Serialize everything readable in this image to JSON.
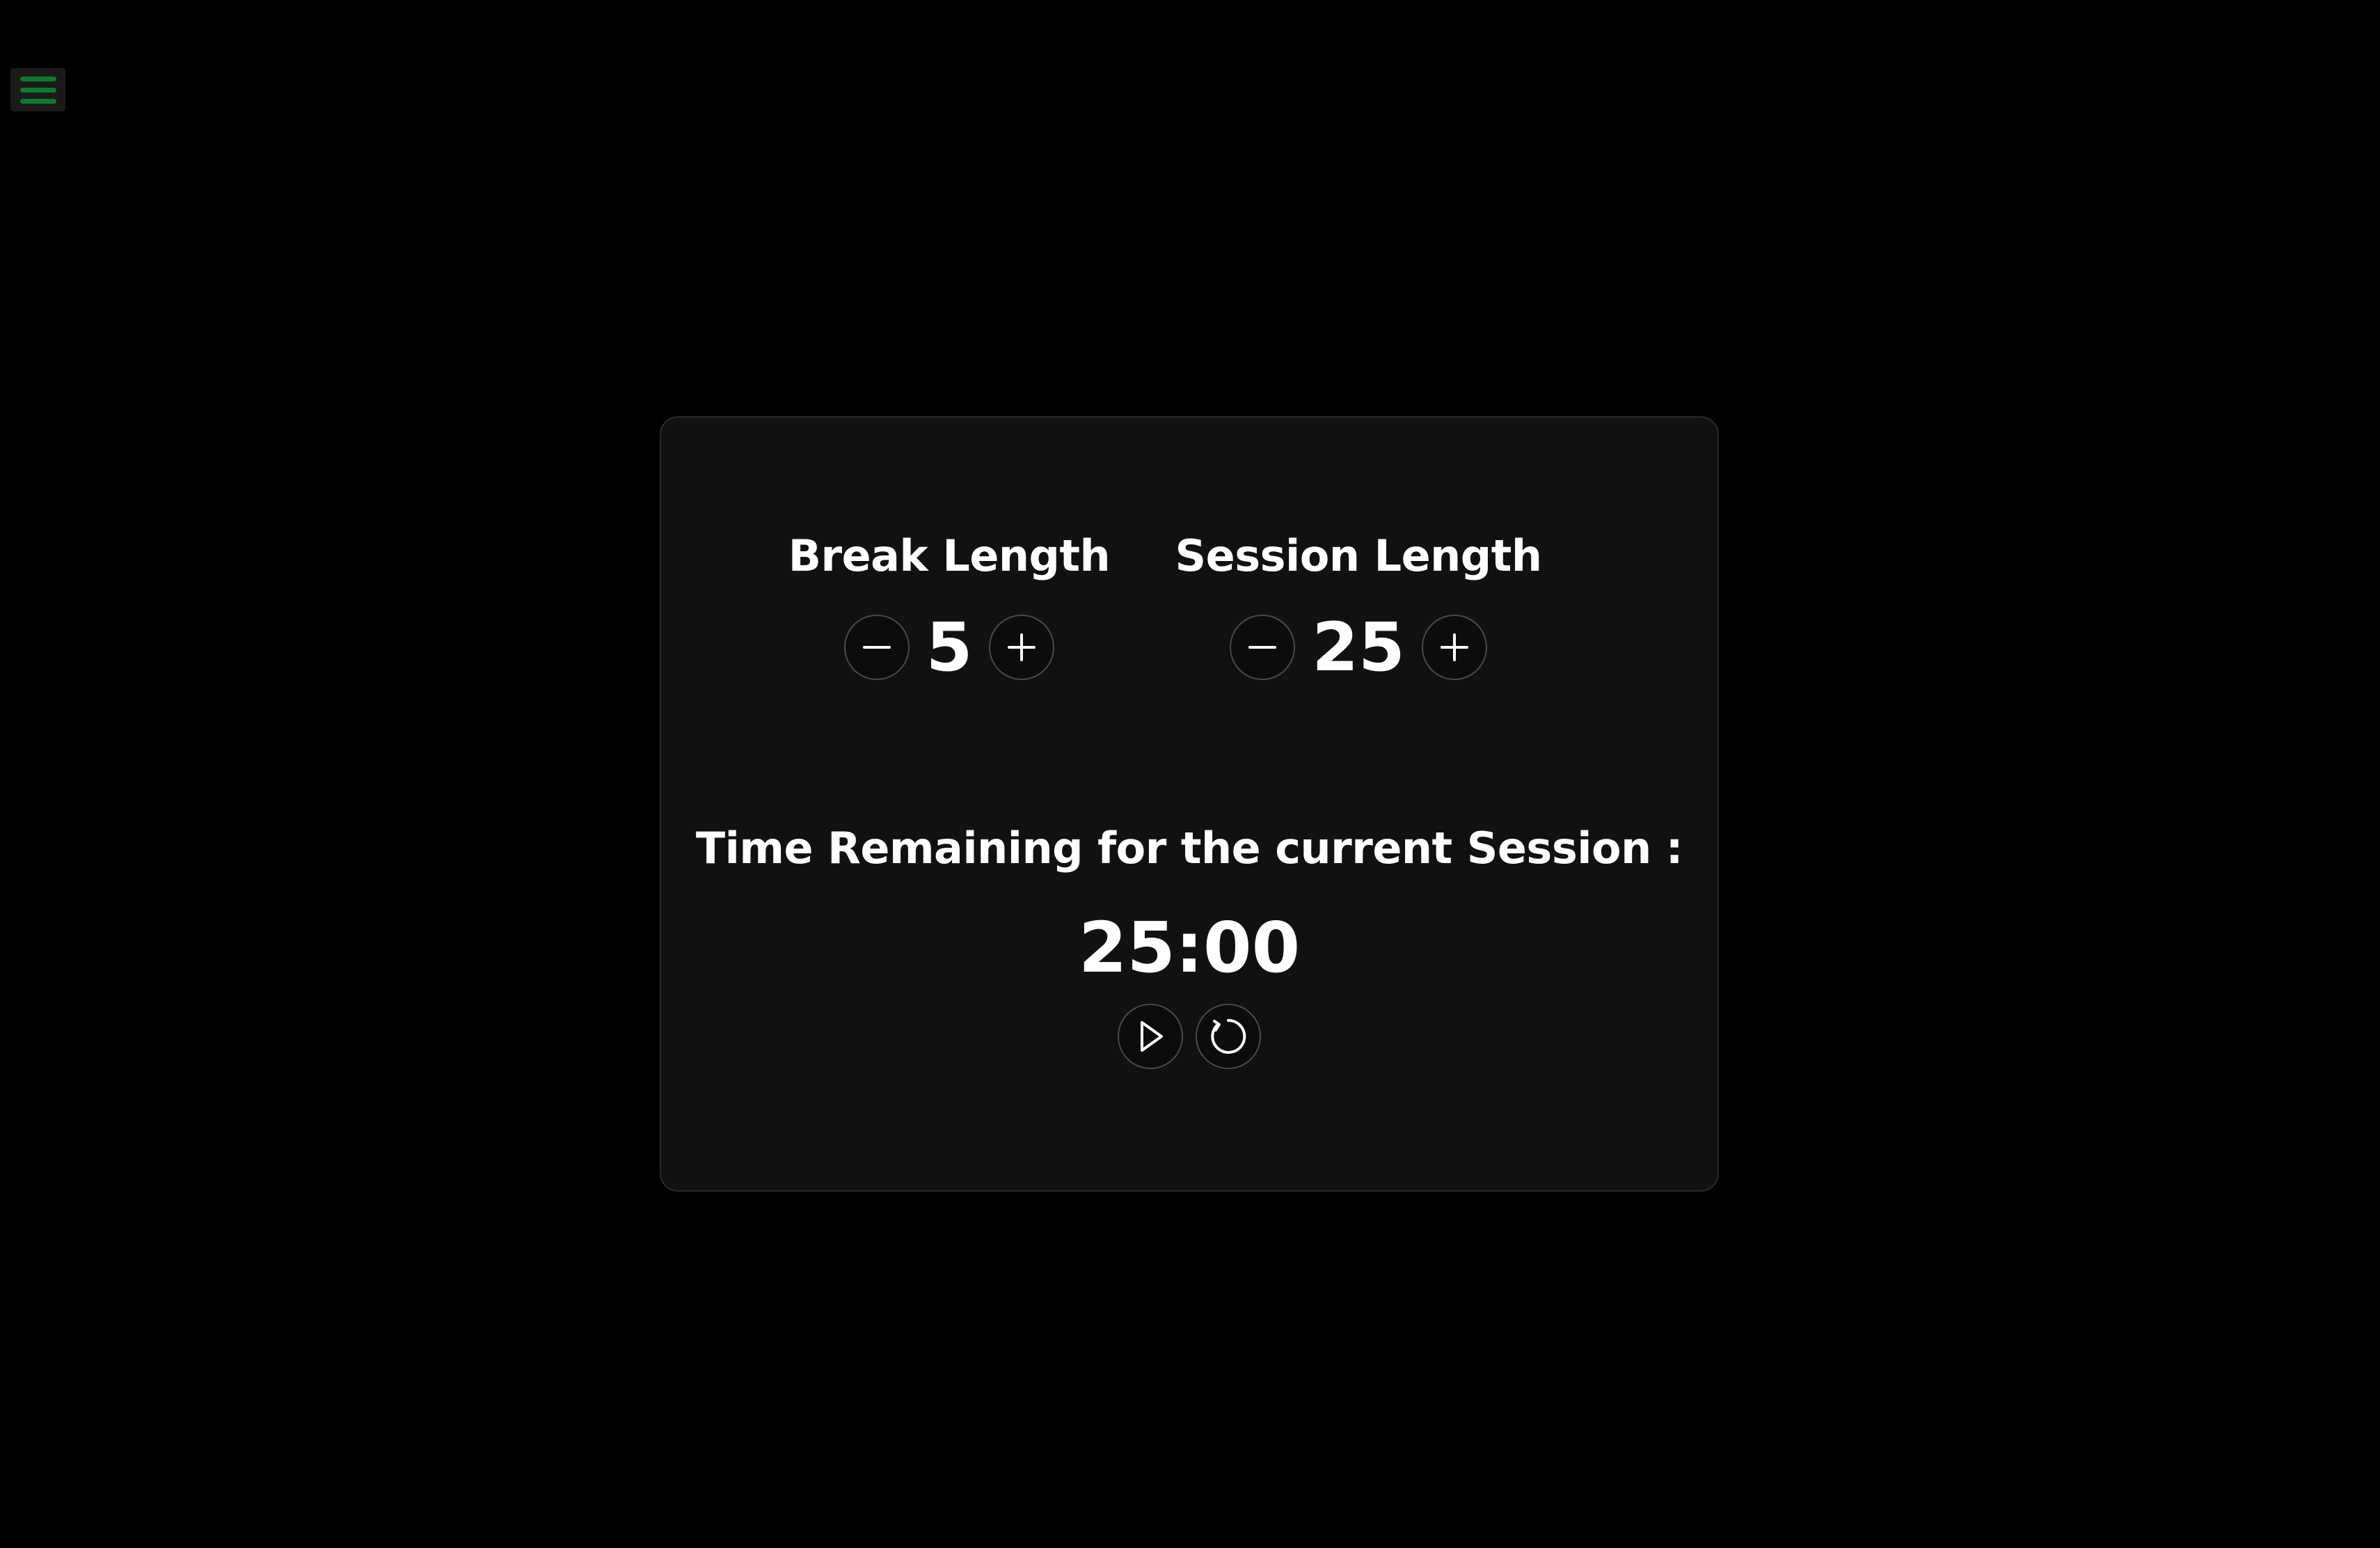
{
  "menu": {
    "icon": "hamburger-icon",
    "accent_color": "#0f7a2a"
  },
  "break": {
    "title": "Break Length",
    "value": "5",
    "decrement_icon": "minus-icon",
    "increment_icon": "plus-icon"
  },
  "session": {
    "title": "Session Length",
    "value": "25",
    "decrement_icon": "minus-icon",
    "increment_icon": "plus-icon"
  },
  "timer": {
    "label": "Time Remaining for the current Session :",
    "value": "25:00",
    "start_icon": "play-icon",
    "reset_icon": "reset-icon"
  },
  "colors": {
    "background": "#000000",
    "card": "#111111",
    "text": "#ffffff"
  }
}
